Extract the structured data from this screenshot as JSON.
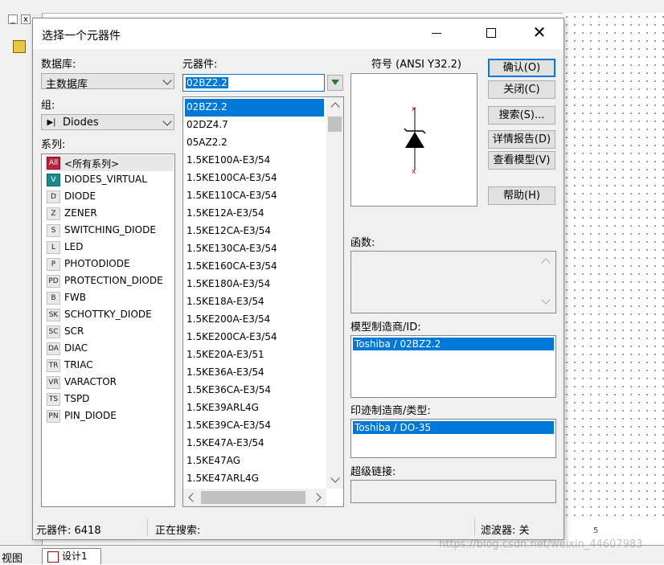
{
  "background": {
    "view_label": "视图",
    "tab_label": "设计1",
    "ruler_label": "5",
    "watermark": "https://blog.csdn.net/weixin_44607983"
  },
  "dialog": {
    "title": "选择一个元器件",
    "database": {
      "label": "数据库:",
      "value": "主数据库"
    },
    "group": {
      "label": "组:",
      "value": "Diodes",
      "icon": "diode-icon"
    },
    "series": {
      "label": "系列:",
      "items": [
        {
          "label": "<所有系列>",
          "icon": "All"
        },
        {
          "label": "DIODES_VIRTUAL",
          "icon": "V"
        },
        {
          "label": "DIODE",
          "icon": "D"
        },
        {
          "label": "ZENER",
          "icon": "Z"
        },
        {
          "label": "SWITCHING_DIODE",
          "icon": "S"
        },
        {
          "label": "LED",
          "icon": "L"
        },
        {
          "label": "PHOTODIODE",
          "icon": "P"
        },
        {
          "label": "PROTECTION_DIODE",
          "icon": "PD"
        },
        {
          "label": "FWB",
          "icon": "B"
        },
        {
          "label": "SCHOTTKY_DIODE",
          "icon": "SK"
        },
        {
          "label": "SCR",
          "icon": "SC"
        },
        {
          "label": "DIAC",
          "icon": "DA"
        },
        {
          "label": "TRIAC",
          "icon": "TR"
        },
        {
          "label": "VARACTOR",
          "icon": "VR"
        },
        {
          "label": "TSPD",
          "icon": "TS"
        },
        {
          "label": "PIN_DIODE",
          "icon": "PN"
        }
      ]
    },
    "component": {
      "label": "元器件:",
      "search_value": "02BZ2.2",
      "items": [
        "02BZ2.2",
        "02DZ4.7",
        "05AZ2.2",
        "1.5KE100A-E3/54",
        "1.5KE100CA-E3/54",
        "1.5KE110CA-E3/54",
        "1.5KE12A-E3/54",
        "1.5KE12CA-E3/54",
        "1.5KE130CA-E3/54",
        "1.5KE160CA-E3/54",
        "1.5KE180A-E3/54",
        "1.5KE18A-E3/54",
        "1.5KE200A-E3/54",
        "1.5KE200CA-E3/54",
        "1.5KE20A-E3/51",
        "1.5KE36A-E3/54",
        "1.5KE36CA-E3/54",
        "1.5KE39ARL4G",
        "1.5KE39CA-E3/54",
        "1.5KE47A-E3/54",
        "1.5KE47AG",
        "1.5KE47ARL4G"
      ]
    },
    "symbol": {
      "label": "符号 (ANSI Y32.2)"
    },
    "function": {
      "label": "函数:"
    },
    "model": {
      "label": "模型制造商/ID:",
      "value": "Toshiba / 02BZ2.2"
    },
    "footprint": {
      "label": "印迹制造商/类型:",
      "value": "Toshiba / DO-35"
    },
    "hyperlink": {
      "label": "超级链接:"
    },
    "buttons": {
      "ok": "确认(O)",
      "close": "关闭(C)",
      "search": "搜索(S)...",
      "report": "详情报告(D)",
      "model": "查看模型(V)",
      "help": "帮助(H)"
    },
    "status": {
      "count": "元器件: 6418",
      "searching": "正在搜索:",
      "filter": "滤波器: 关"
    }
  }
}
